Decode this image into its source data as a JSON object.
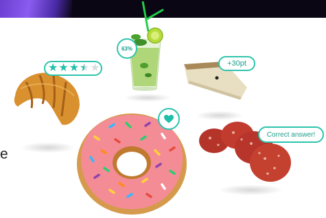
{
  "header": {
    "band": "top-gradient-band"
  },
  "left_text": "e",
  "drink": {
    "percent_label": "63%"
  },
  "croissant": {
    "rating": 3.5,
    "max_rating": 5,
    "stars": [
      "★",
      "★",
      "★",
      "★",
      "★"
    ]
  },
  "cheese": {
    "points_label": "+30pt"
  },
  "donut": {
    "badge_icon": "heart-icon"
  },
  "salami": {
    "answer_label": "Correct answer!"
  },
  "colors": {
    "accent": "#2dc3ac",
    "accent_text": "#1a9b88",
    "star_empty": "#d9dde0"
  }
}
